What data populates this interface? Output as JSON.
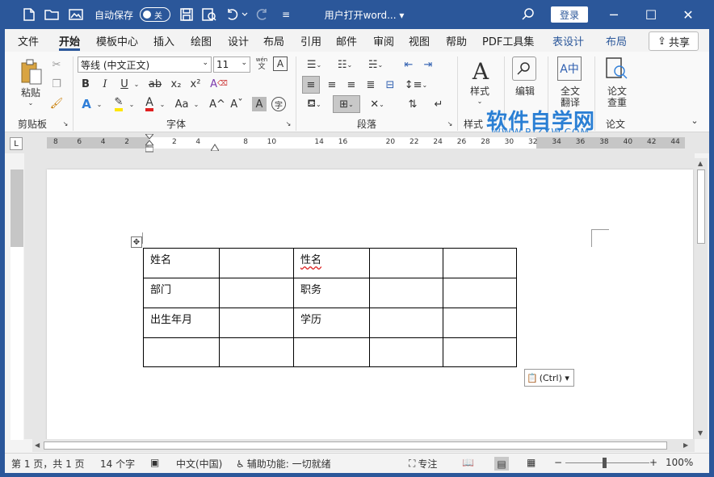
{
  "titlebar": {
    "autosave_label": "自动保存",
    "autosave_state": "关",
    "doc_title": "用户打开word... ▾",
    "login": "登录",
    "save_icon": "save-icon",
    "undo_icon": "undo-icon",
    "redo_icon": "redo-icon"
  },
  "tabs": [
    "文件",
    "开始",
    "模板中心",
    "插入",
    "绘图",
    "设计",
    "布局",
    "引用",
    "邮件",
    "审阅",
    "视图",
    "帮助",
    "PDF工具集",
    "表设计",
    "布局"
  ],
  "share_label": "共享",
  "ribbon": {
    "clipboard": {
      "paste": "粘贴",
      "label": "剪贴板"
    },
    "font": {
      "name": "等线 (中文正文)",
      "size": "11",
      "label": "字体",
      "wen": "wén",
      "wen_char": "文",
      "bold": "B",
      "italic": "I",
      "underline": "U",
      "strike": "ab",
      "sub": "x₂",
      "sup": "x²",
      "clear": "A",
      "color_a": "A",
      "aa": "Aa",
      "grow": "A^",
      "shrink": "Aˇ",
      "boxA": "A",
      "circle": "字",
      "A_box": "A"
    },
    "paragraph": {
      "label": "段落"
    },
    "styles": {
      "label": "样式",
      "btn": "样式"
    },
    "editing": {
      "btn": "编辑"
    },
    "translate": {
      "btn_line1": "全文",
      "btn_line2": "翻译"
    },
    "paper": {
      "btn_line1": "论文",
      "btn_line2": "查重",
      "label": "论文"
    }
  },
  "watermark": {
    "main": "软件自学网",
    "sub": "WWW.RJZXW.COM"
  },
  "ruler": {
    "numbers": [
      "8",
      "6",
      "4",
      "2",
      "",
      "2",
      "4",
      "",
      "8",
      "10",
      "",
      "14",
      "16",
      "",
      "20",
      "22",
      "24",
      "26",
      "28",
      "30",
      "32",
      "34",
      "36",
      "38",
      "40",
      "42",
      "44"
    ],
    "corner": "L"
  },
  "table": {
    "rows": [
      [
        "姓名",
        "",
        "性名",
        "",
        ""
      ],
      [
        "部门",
        "",
        "职务",
        "",
        ""
      ],
      [
        "出生年月",
        "",
        "学历",
        "",
        ""
      ],
      [
        "",
        "",
        "",
        "",
        ""
      ]
    ]
  },
  "paste_options": "(Ctrl) ▾",
  "status": {
    "page": "第 1 页，共 1 页",
    "words": "14 个字",
    "lang": "中文(中国)",
    "accessibility": "辅助功能: 一切就绪",
    "focus": "专注",
    "zoom": "100%"
  }
}
